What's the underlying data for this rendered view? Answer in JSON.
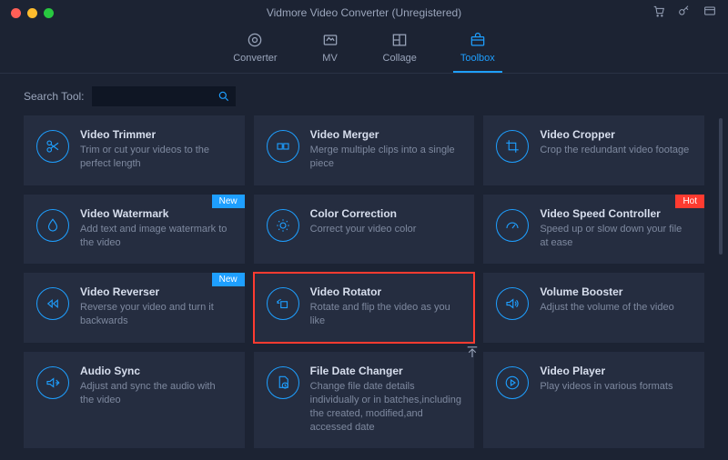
{
  "window": {
    "title": "Vidmore Video Converter (Unregistered)"
  },
  "tabs": {
    "converter": "Converter",
    "mv": "MV",
    "collage": "Collage",
    "toolbox": "Toolbox"
  },
  "search": {
    "label": "Search Tool:",
    "value": ""
  },
  "cards": {
    "trimmer": {
      "title": "Video Trimmer",
      "desc": "Trim or cut your videos to the perfect length"
    },
    "merger": {
      "title": "Video Merger",
      "desc": "Merge multiple clips into a single piece"
    },
    "cropper": {
      "title": "Video Cropper",
      "desc": "Crop the redundant video footage"
    },
    "watermark": {
      "title": "Video Watermark",
      "desc": "Add text and image watermark to the video",
      "badge": "New"
    },
    "color": {
      "title": "Color Correction",
      "desc": "Correct your video color"
    },
    "speed": {
      "title": "Video Speed Controller",
      "desc": "Speed up or slow down your file at ease",
      "badge": "Hot"
    },
    "reverser": {
      "title": "Video Reverser",
      "desc": "Reverse your video and turn it backwards",
      "badge": "New"
    },
    "rotator": {
      "title": "Video Rotator",
      "desc": "Rotate and flip the video as you like"
    },
    "volume": {
      "title": "Volume Booster",
      "desc": "Adjust the volume of the video"
    },
    "sync": {
      "title": "Audio Sync",
      "desc": "Adjust and sync the audio with the video"
    },
    "date": {
      "title": "File Date Changer",
      "desc": "Change file date details individually or in batches,including the created, modified,and accessed date"
    },
    "player": {
      "title": "Video Player",
      "desc": "Play videos in various formats"
    }
  }
}
